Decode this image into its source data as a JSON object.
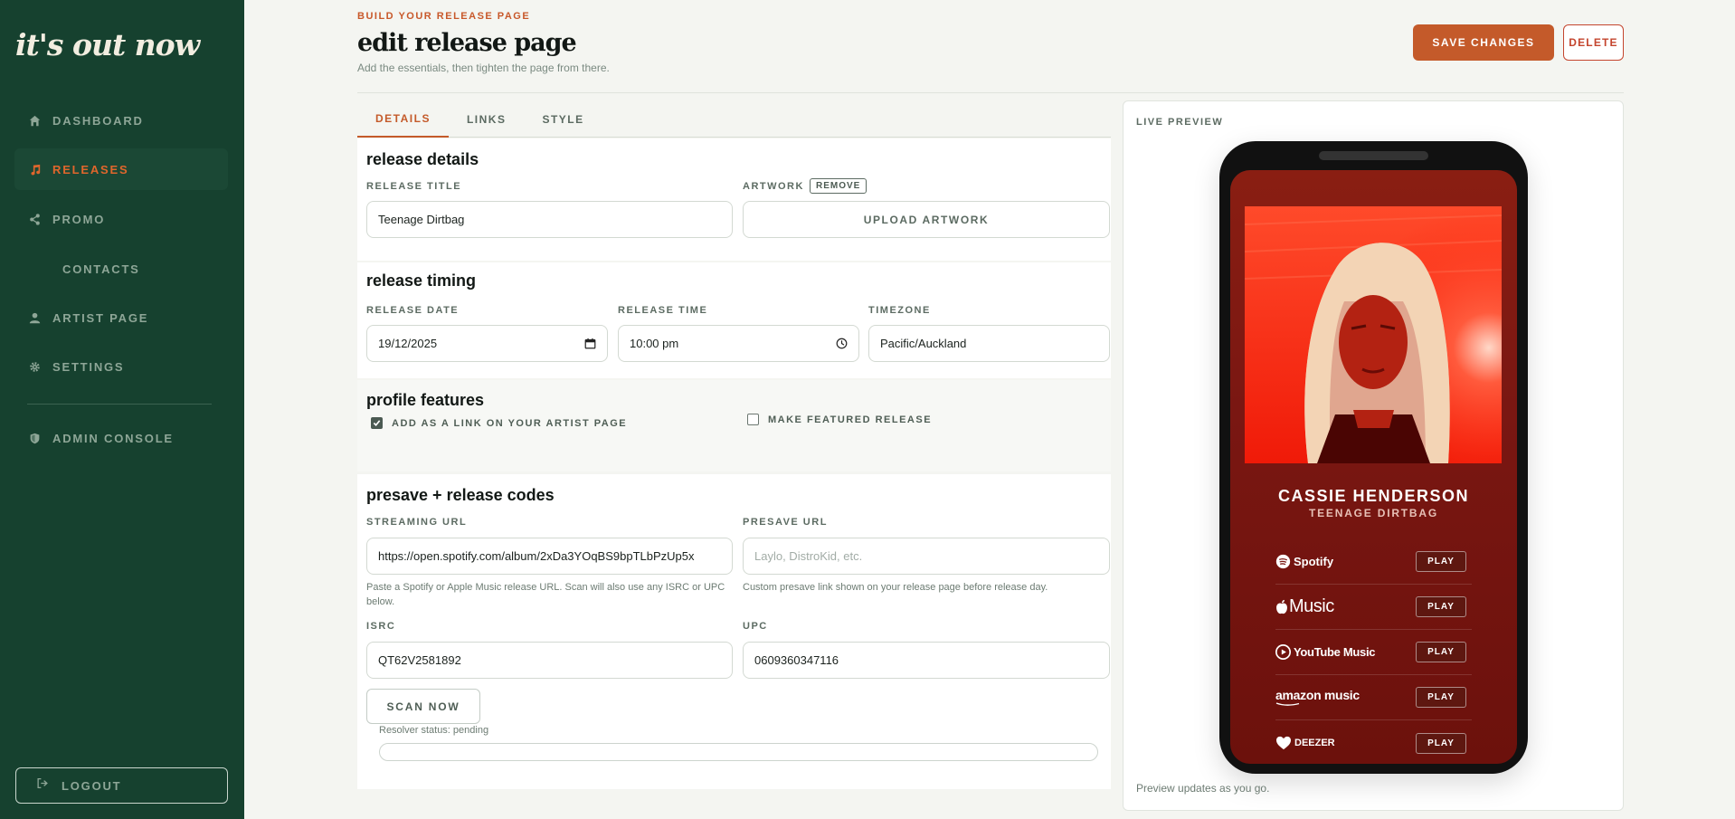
{
  "brand": "it's out now",
  "sidebar": {
    "items": [
      {
        "label": "DASHBOARD",
        "icon": "home-icon"
      },
      {
        "label": "RELEASES",
        "icon": "music-note-icon"
      },
      {
        "label": "PROMO",
        "icon": "share-icon"
      },
      {
        "label": "CONTACTS"
      },
      {
        "label": "ARTIST PAGE",
        "icon": "user-icon"
      },
      {
        "label": "SETTINGS",
        "icon": "gear-icon"
      },
      {
        "label": "ADMIN CONSOLE",
        "icon": "shield-icon"
      }
    ],
    "logout_label": "LOGOUT"
  },
  "header": {
    "eyebrow": "BUILD YOUR RELEASE PAGE",
    "title": "edit release page",
    "subtitle": "Add the essentials, then tighten the page from there.",
    "save_label": "SAVE CHANGES",
    "delete_label": "DELETE"
  },
  "tabs": [
    {
      "label": "DETAILS",
      "active": true
    },
    {
      "label": "LINKS",
      "active": false
    },
    {
      "label": "STYLE",
      "active": false
    }
  ],
  "release_details": {
    "title": "release details",
    "release_title_label": "RELEASE TITLE",
    "release_title_value": "Teenage Dirtbag",
    "artwork_label": "ARTWORK",
    "remove_label": "REMOVE",
    "upload_label": "UPLOAD ARTWORK"
  },
  "release_timing": {
    "title": "release timing",
    "date_label": "RELEASE DATE",
    "date_value": "19/12/2025",
    "time_label": "RELEASE TIME",
    "time_value": "10:00 pm",
    "timezone_label": "TIMEZONE",
    "timezone_value": "Pacific/Auckland"
  },
  "profile_features": {
    "title": "profile features",
    "add_link_label": "ADD AS A LINK ON YOUR ARTIST PAGE",
    "add_link_checked": true,
    "featured_label": "MAKE FEATURED RELEASE",
    "featured_checked": false
  },
  "codes": {
    "title": "presave + release codes",
    "streaming_label": "STREAMING URL",
    "streaming_value": "https://open.spotify.com/album/2xDa3YOqBS9bpTLbPzUp5x",
    "streaming_help": "Paste a Spotify or Apple Music release URL. Scan will also use any ISRC or UPC below.",
    "presave_label": "PRESAVE URL",
    "presave_placeholder": "Laylo, DistroKid, etc.",
    "presave_help": "Custom presave link shown on your release page before release day.",
    "isrc_label": "ISRC",
    "isrc_value": "QT62V2581892",
    "upc_label": "UPC",
    "upc_value": "0609360347116",
    "scan_label": "SCAN NOW",
    "resolver_status": "Resolver status: pending",
    "progress": 0
  },
  "preview": {
    "label": "LIVE PREVIEW",
    "footer": "Preview updates as you go.",
    "artist": "CASSIE HENDERSON",
    "release": "TEENAGE DIRTBAG",
    "play_label": "PLAY",
    "services": [
      "Spotify",
      "Music",
      "YouTube Music",
      "amazon music",
      "DEEZER"
    ]
  },
  "colors": {
    "sidebar": "#16412f",
    "accent": "#c45a2a",
    "danger": "#c4452e",
    "preview_bg": "#7a1712"
  }
}
